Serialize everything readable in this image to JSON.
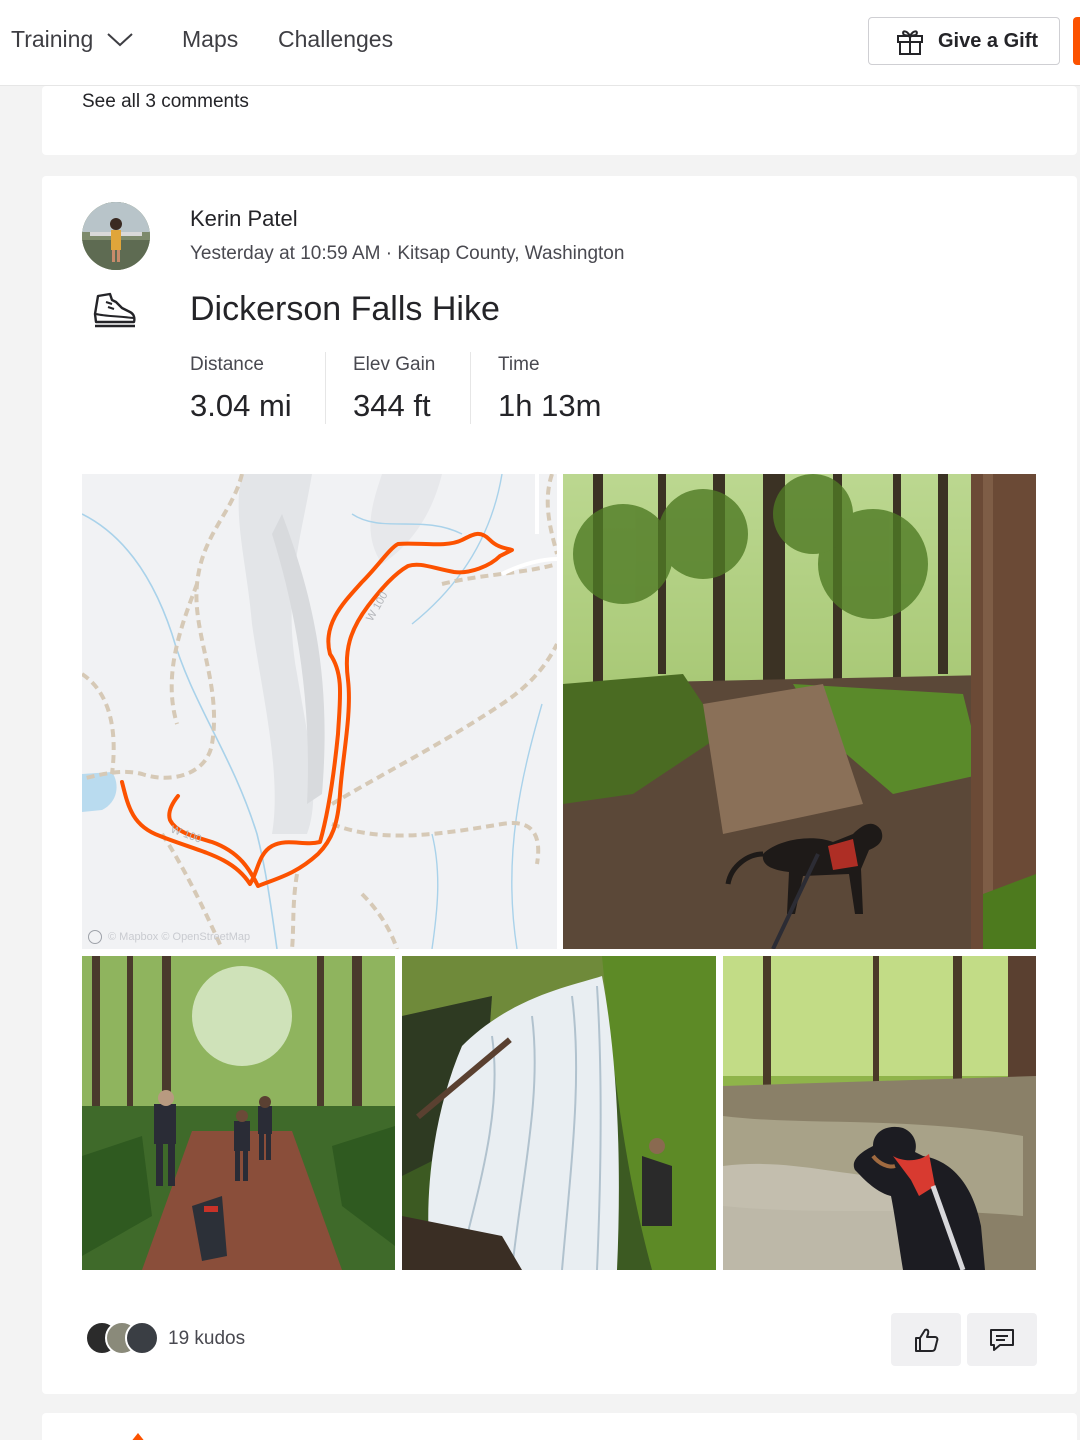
{
  "nav": {
    "items": [
      {
        "label": "Training"
      },
      {
        "label": "Maps"
      },
      {
        "label": "Challenges"
      }
    ],
    "gift_label": "Give a Gift"
  },
  "prev_card": {
    "comments_link": "See all 3 comments"
  },
  "activity": {
    "athlete": "Kerin Patel",
    "meta": "Yesterday at 10:59 AM · Kitsap County, Washington",
    "type_icon": "hiking-shoe-icon",
    "title": "Dickerson Falls Hike",
    "stats": [
      {
        "label": "Distance",
        "value": "3.04 mi"
      },
      {
        "label": "Elev Gain",
        "value": "344 ft"
      },
      {
        "label": "Time",
        "value": "1h 13m"
      }
    ],
    "map_attribution": "© Mapbox © OpenStreetMap",
    "kudos_text": "19 kudos"
  },
  "colors": {
    "brand": "#fc5200",
    "route": "#fc5200"
  }
}
